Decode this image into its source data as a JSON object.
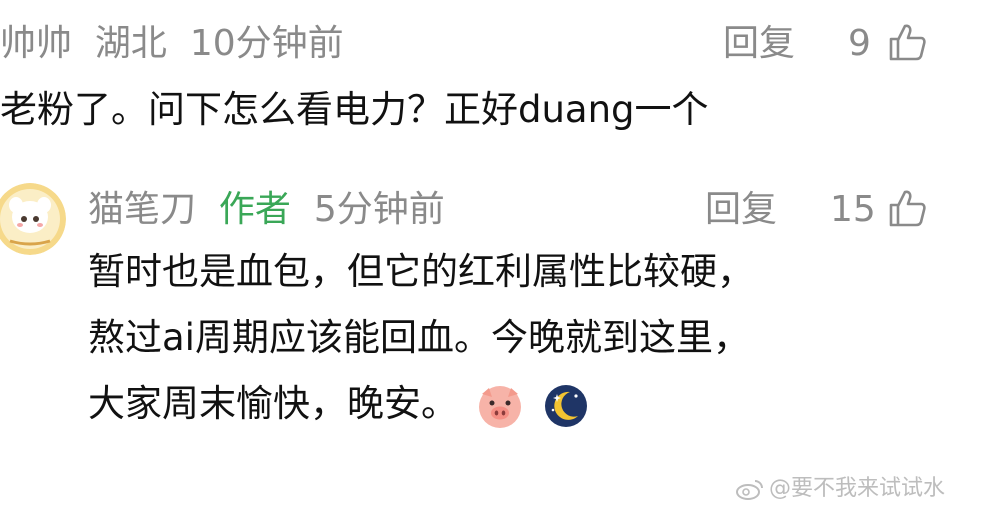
{
  "comment1": {
    "username": "帅帅",
    "location": "湖北",
    "time": "10分钟前",
    "reply_label": "回复",
    "like_count": "9",
    "text": "老粉了。问下怎么看电力？正好duang一个"
  },
  "comment2": {
    "username": "猫笔刀",
    "author_tag": "作者",
    "time": "5分钟前",
    "reply_label": "回复",
    "like_count": "15",
    "lines": [
      "暂时也是血包，但它的红利属性比较硬，",
      "熬过ai周期应该能回血。今晚就到这里，",
      "大家周末愉快，晚安。"
    ],
    "emojis": [
      "pig-face",
      "crescent-moon"
    ]
  },
  "watermark": "@要不我来试试水",
  "colors": {
    "meta": "#8a8a8a",
    "text": "#111111",
    "author_tag": "#3aa757",
    "watermark": "#bdbdbd"
  }
}
